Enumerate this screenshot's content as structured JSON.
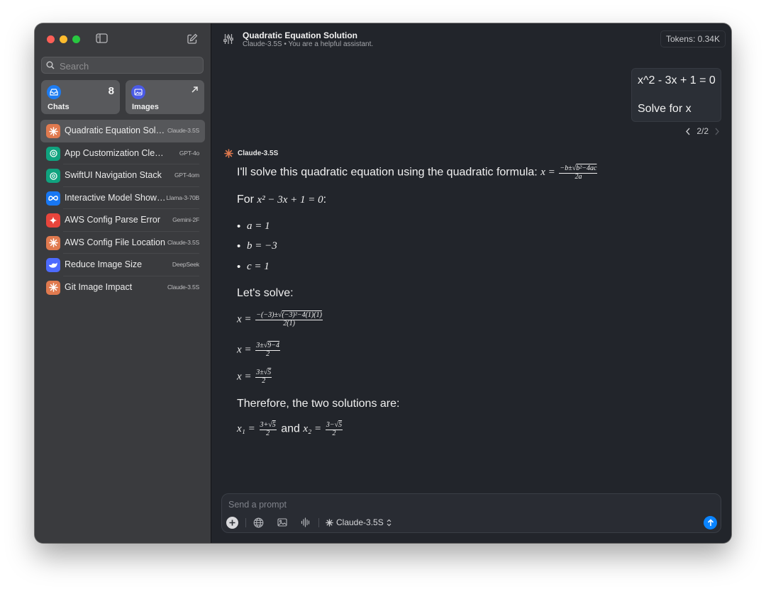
{
  "sidebar": {
    "search_placeholder": "Search",
    "cards": {
      "chats": {
        "label": "Chats",
        "count": "8"
      },
      "images": {
        "label": "Images"
      }
    },
    "chats": [
      {
        "title": "Quadratic Equation Solut...",
        "model": "Claude-3.5S",
        "icon": "claude-icon",
        "active": true
      },
      {
        "title": "App Customization Cleanup",
        "model": "GPT-4o",
        "icon": "openai-icon"
      },
      {
        "title": "SwiftUI Navigation Stack",
        "model": "GPT-4om",
        "icon": "openai-icon"
      },
      {
        "title": "Interactive Model Showc...",
        "model": "Llama-3-70B",
        "icon": "meta-icon"
      },
      {
        "title": "AWS Config Parse Error",
        "model": "Gemini-2F",
        "icon": "gemini-icon"
      },
      {
        "title": "AWS Config File Location",
        "model": "Claude-3.5S",
        "icon": "claude-icon"
      },
      {
        "title": "Reduce Image Size",
        "model": "DeepSeek",
        "icon": "deepseek-icon"
      },
      {
        "title": "Git Image Impact",
        "model": "Claude-3.5S",
        "icon": "claude-icon"
      }
    ]
  },
  "header": {
    "title": "Quadratic Equation Solution",
    "subtitle": "Claude-3.5S • You are a helpful assistant.",
    "tokens": "Tokens: 0.34K"
  },
  "user_message": {
    "line1": "x^2 - 3x + 1 = 0",
    "line2": "Solve for x"
  },
  "pager": "2/2",
  "assistant": {
    "name": "Claude-3.5S",
    "intro": "I'll solve this quadratic equation using the quadratic formula:",
    "for_label": "For",
    "lets_solve": "Let's solve:",
    "therefore": "Therefore, the two solutions are:",
    "and": "and"
  },
  "composer": {
    "placeholder": "Send a prompt",
    "model": "Claude-3.5S"
  },
  "colors": {
    "claude": "#e07a4f",
    "openai": "#10a37f",
    "meta": "#1877f2",
    "gemini": "#e8453c",
    "deepseek": "#4d6bfe",
    "send": "#0a84ff"
  }
}
